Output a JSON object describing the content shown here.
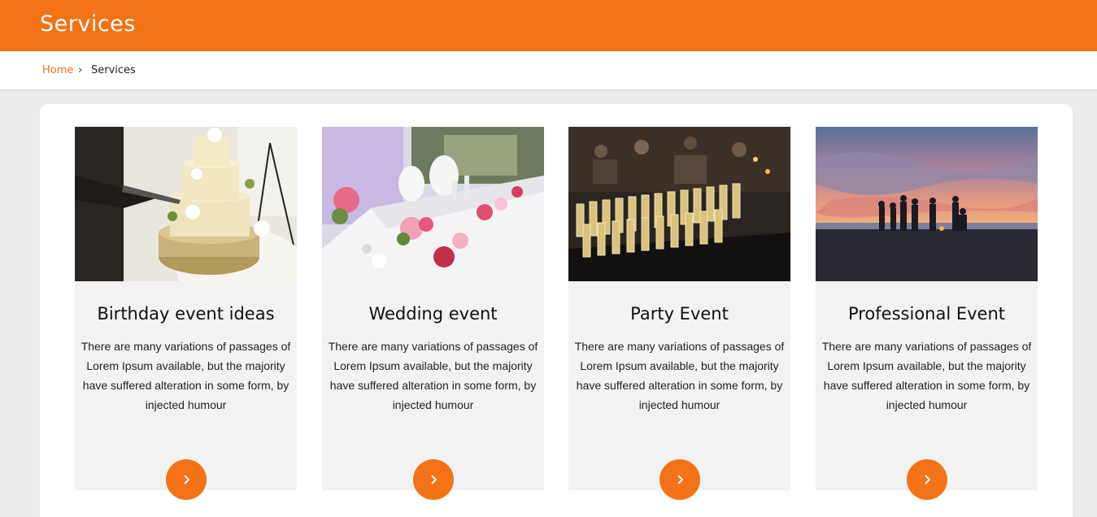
{
  "header": {
    "title": "Services"
  },
  "breadcrumb": {
    "home": "Home",
    "separator": "›",
    "current": "Services"
  },
  "colors": {
    "accent": "#f47216",
    "card_bg": "#f2f2f2",
    "page_bg": "#ebebeb"
  },
  "services": [
    {
      "title": "Birthday event ideas",
      "description": "There are many variations of passages of Lorem Ipsum available, but the majority have suffered alteration in some form, by injected humour",
      "image": "birthday-cake-photo",
      "button_icon": "chevron-right-icon"
    },
    {
      "title": "Wedding event",
      "description": "There are many variations of passages of Lorem Ipsum available, but the majority have suffered alteration in some form, by injected humour",
      "image": "wedding-table-photo",
      "button_icon": "chevron-right-icon"
    },
    {
      "title": "Party Event",
      "description": "There are many variations of passages of Lorem Ipsum available, but the majority have suffered alteration in some form, by injected humour",
      "image": "champagne-glasses-photo",
      "button_icon": "chevron-right-icon"
    },
    {
      "title": "Professional Event",
      "description": "There are many variations of passages of Lorem Ipsum available, but the majority have suffered alteration in some form, by injected humour",
      "image": "beach-sunset-photo",
      "button_icon": "chevron-right-icon"
    }
  ]
}
